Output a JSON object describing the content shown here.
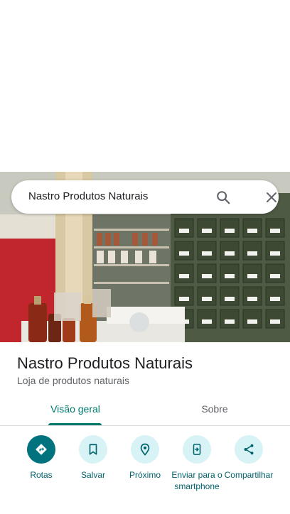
{
  "search": {
    "query": "Nastro Produtos Naturais"
  },
  "place": {
    "name": "Nastro Produtos Naturais",
    "category": "Loja de produtos naturais"
  },
  "tabs": [
    {
      "label": "Visão geral",
      "selected": true
    },
    {
      "label": "Sobre",
      "selected": false
    }
  ],
  "actions": [
    {
      "label": "Rotas",
      "icon": "directions-icon"
    },
    {
      "label": "Salvar",
      "icon": "bookmark-icon"
    },
    {
      "label": "Próximo",
      "icon": "nearby-icon"
    },
    {
      "label": "Enviar para o smartphone",
      "icon": "send-to-phone-icon"
    },
    {
      "label": "Compartilhar",
      "icon": "share-icon"
    }
  ],
  "colors": {
    "accent": "#00796b",
    "action_bg": "#d7f3f6",
    "primary_action_bg": "#00737e"
  }
}
